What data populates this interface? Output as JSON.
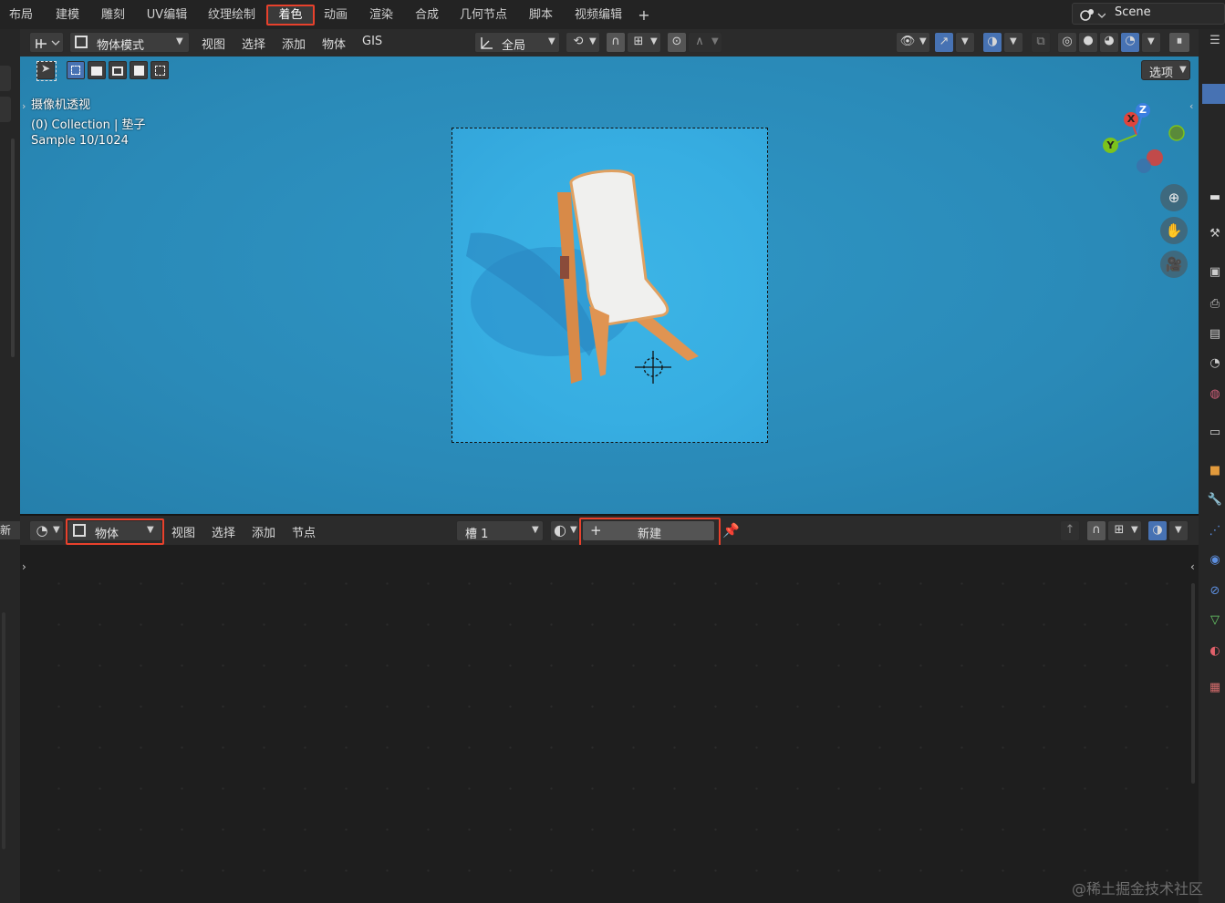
{
  "workspace_tabs": [
    "布局",
    "建模",
    "雕刻",
    "UV编辑",
    "纹理绘制",
    "着色",
    "动画",
    "渲染",
    "合成",
    "几何节点",
    "脚本",
    "视频编辑"
  ],
  "active_tab": "着色",
  "add_tab": "+",
  "scene": {
    "name": "Scene"
  },
  "viewport_header": {
    "mode": "物体模式",
    "menus": [
      "视图",
      "选择",
      "添加",
      "物体",
      "GIS"
    ],
    "transform_orientation": "全局"
  },
  "viewport": {
    "options_label": "选项",
    "overlay_lines": [
      "摄像机透视",
      "(0) Collection | 垫子",
      "Sample 10/1024"
    ],
    "gizmo_axes": {
      "z": "Z",
      "x": "X",
      "y": "Y"
    },
    "colors": {
      "background": "#2a8ab8",
      "camera_region": "#37aee2",
      "axis_x": "#e0443c",
      "axis_y": "#7cc31c",
      "axis_z": "#3a7fe0"
    }
  },
  "node_editor_header": {
    "left_clipped_label": "新建",
    "object_type": "物体",
    "menus": [
      "视图",
      "选择",
      "添加",
      "节点"
    ],
    "slot": "槽 1",
    "new_button": "新建",
    "new_button_prefix": "+"
  },
  "watermark": "@稀土掘金技术社区",
  "highlight_color": "#e8412c"
}
